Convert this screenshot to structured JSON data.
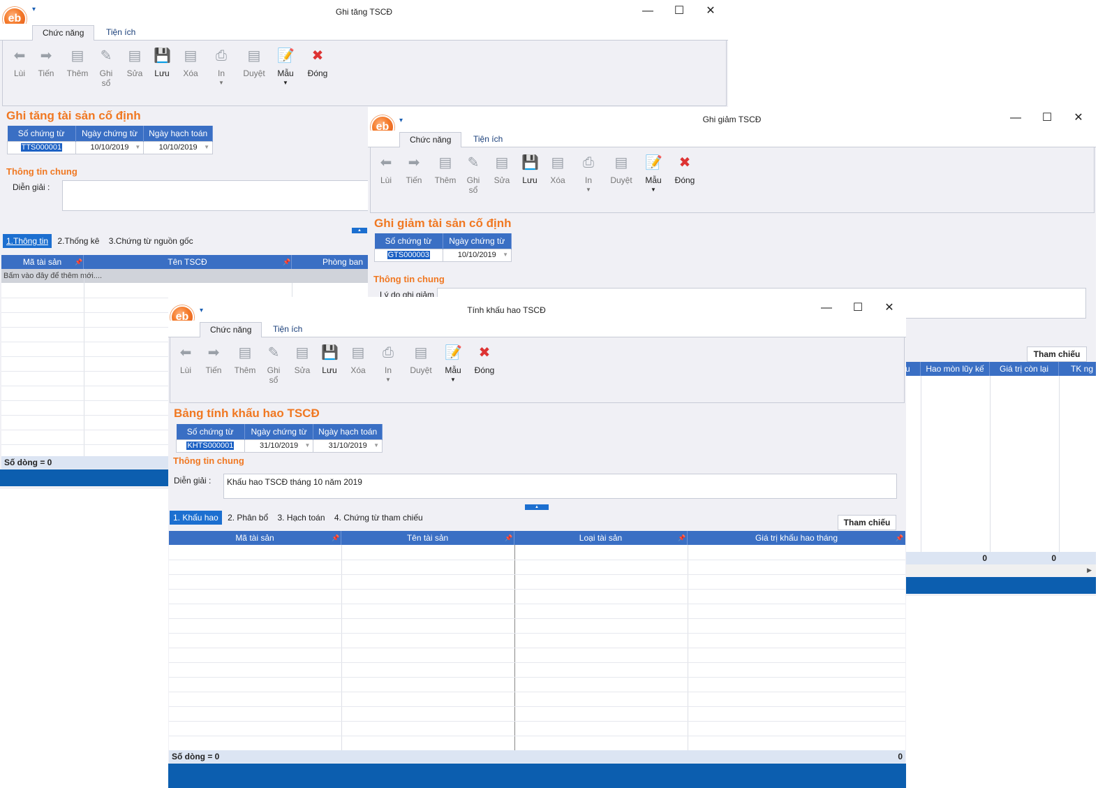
{
  "w1": {
    "title": "Ghi tăng TSCĐ",
    "tabs": [
      "Chức năng",
      "Tiện ích"
    ],
    "buttons": [
      "Lùi",
      "Tiến",
      "Thêm",
      "Ghi\nsổ",
      "Sửa",
      "Lưu",
      "Xóa",
      "In",
      "Duyệt",
      "Mẫu",
      "Đóng"
    ],
    "heading": "Ghi tăng tài sản cố định",
    "doc_headers": [
      "Số chứng từ",
      "Ngày chứng từ",
      "Ngày hạch toán"
    ],
    "doc_values": [
      "TTS000001",
      "10/10/2019",
      "10/10/2019"
    ],
    "section": "Thông tin chung",
    "desc_label": "Diễn giải :",
    "subtabs": [
      "1.Thông tin",
      "2.Thống kê",
      "3.Chứng từ nguồn gốc"
    ],
    "grid_headers": [
      "Mã tài sản",
      "Tên TSCĐ",
      "Phòng ban"
    ],
    "add_row": "Bấm vào đây để thêm mới....",
    "footer": "Số dòng = 0"
  },
  "w2": {
    "title": "Ghi giảm TSCĐ",
    "tabs": [
      "Chức năng",
      "Tiện ích"
    ],
    "buttons": [
      "Lùi",
      "Tiến",
      "Thêm",
      "Ghi\nsổ",
      "Sửa",
      "Lưu",
      "Xóa",
      "In",
      "Duyệt",
      "Mẫu",
      "Đóng"
    ],
    "heading": "Ghi giảm tài sản cố định",
    "doc_headers": [
      "Số chứng từ",
      "Ngày chứng từ"
    ],
    "doc_values": [
      "GTS000003",
      "10/10/2019"
    ],
    "section": "Thông tin chung",
    "reason_label": "Lý do ghi giảm :",
    "ref_button": "Tham chiếu",
    "grid_headers": [
      "u",
      "Hao mòn lũy kế",
      "Giá trị còn lại",
      "TK ng"
    ],
    "footer_values": [
      "0",
      "0"
    ]
  },
  "w3": {
    "title": "Tính khấu hao TSCĐ",
    "tabs": [
      "Chức năng",
      "Tiện ích"
    ],
    "buttons": [
      "Lùi",
      "Tiến",
      "Thêm",
      "Ghi\nsổ",
      "Sửa",
      "Lưu",
      "Xóa",
      "In",
      "Duyệt",
      "Mẫu",
      "Đóng"
    ],
    "heading": "Bảng tính khấu hao TSCĐ",
    "doc_headers": [
      "Số chứng từ",
      "Ngày chứng từ",
      "Ngày hạch toán"
    ],
    "doc_values": [
      "KHTS000001",
      "31/10/2019",
      "31/10/2019"
    ],
    "section": "Thông tin chung",
    "desc_label": "Diễn giải :",
    "desc_value": "Khấu hao TSCĐ tháng 10 năm 2019",
    "subtabs": [
      "1. Khấu hao",
      "2. Phân bổ",
      "3. Hạch toán",
      "4. Chứng từ tham chiếu"
    ],
    "ref_button": "Tham chiếu",
    "grid_headers": [
      "Mã tài sản",
      "Tên tài sản",
      "Loại tài sản",
      "Giá trị khấu hao tháng"
    ],
    "footer": "Số dòng = 0",
    "footer_total": "0"
  },
  "window_controls": [
    "—",
    "☐",
    "✕"
  ],
  "logo_text": "eb"
}
